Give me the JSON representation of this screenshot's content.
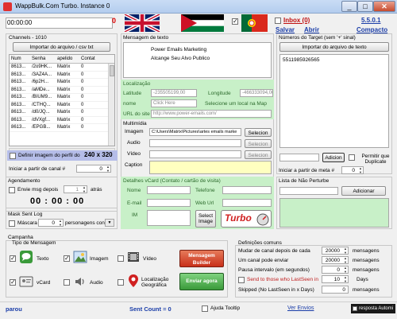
{
  "window": {
    "title": "WappBulk.Com Turbo. Instance 0",
    "min": "_",
    "max": "□",
    "close": "✕"
  },
  "top": {
    "timer": "00:00:00",
    "counter": "0",
    "inbox_label": "Inbox (0)",
    "version": "5.5.0.1",
    "links": [
      "Salvar",
      "Abrir",
      "Compacto"
    ]
  },
  "channels": {
    "title": "Channels - 1010",
    "import_button": "Importar do arquivo / csv txt",
    "columns": [
      "Num",
      "Senha",
      "apelido",
      "Contat"
    ],
    "rows": [
      [
        "8613...",
        "/2o9HK...",
        "Matrix",
        "0"
      ],
      [
        "8613...",
        "/3AZ4A...",
        "Matrix",
        "0"
      ],
      [
        "8613...",
        "/6p2H...",
        "Matrix",
        "0"
      ],
      [
        "8613...",
        "/aMDe...",
        "Matrix",
        "0"
      ],
      [
        "8613...",
        "/BIUM9...",
        "Matrix",
        "0"
      ],
      [
        "8613...",
        "/CTHQ...",
        "Matrix",
        "0"
      ],
      [
        "8613...",
        "/d0/JQ...",
        "Matrix",
        "0"
      ],
      [
        "8613...",
        "/dVXgf...",
        "Matrix",
        "0"
      ],
      [
        "8613...",
        "/EPGB...",
        "Matrix",
        "0"
      ]
    ],
    "profile_image_label": "Definir imagem do perfil do",
    "profile_size": "240 x 320",
    "start_channel_label": "Iniciar a partir de canal #",
    "start_channel_value": "0"
  },
  "message": {
    "title": "Mensagem de texto",
    "lines": [
      "Power Emails Marketing",
      "Alcange Seu Alvo Publico"
    ]
  },
  "location": {
    "title": "Localização",
    "latitude_label": "Latitude",
    "latitude_value": "-235505199,00",
    "longitude_label": "Longitude",
    "longitude_value": "-466333094,00",
    "name_label": "nome",
    "name_placeholder": "Click Here",
    "map_hint": "Selecione um local na Map",
    "url_label": "URL do site",
    "url_value": "http://www.power-emails.com/"
  },
  "media": {
    "title": "Multimídia",
    "image_label": "Imagem",
    "image_path": "C:\\Users\\Matrix\\Pictures\\artes emails marke",
    "audio_label": "Audio",
    "video_label": "Vídeo",
    "caption_label": "Caption",
    "select_button": "Selecion"
  },
  "vcard": {
    "title": "Detalhes vCard (Contato / cartão de visita)",
    "name_label": "Nome",
    "phone_label": "Telefone",
    "email_label": "E-mail",
    "web_label": "Web Url",
    "im_label": "IM",
    "select_image_button": "Select Image",
    "turbo_logo": "Turbo"
  },
  "targets": {
    "title": "Números do Target (sem '+' sinal)",
    "import_button": "Importar do arquivo de texto",
    "numbers": [
      "5511985926565"
    ],
    "add_button": "Adicion",
    "allow_duplicate_label": "Permitir que Duplicate",
    "start_meta_label": "Iniciar a partir de meta #",
    "start_meta_value": "0"
  },
  "blacklist": {
    "title": "Lista de Não Perturbe",
    "add_button": "Adicionar"
  },
  "schedule": {
    "title": "Agendamento",
    "send_after_label": "Envie msg depois",
    "send_after_value": "1",
    "unit": "atrás",
    "clock": "00 : 00 : 00"
  },
  "mask": {
    "title": "Mask Sent Log",
    "mask_label": "Máscara",
    "mask_value": "0",
    "per_contact_label": "personagens con"
  },
  "campaign": {
    "title": "Campanha",
    "type_title": "Tipo de Mensagem",
    "types": [
      {
        "label": "Texto",
        "checked": true
      },
      {
        "label": "Imagem",
        "checked": true
      },
      {
        "label": "Vídeo",
        "checked": false
      },
      {
        "label": "vCard",
        "checked": true
      },
      {
        "label": "Audio",
        "checked": false
      },
      {
        "label": "Localização Geográfica",
        "checked": false
      }
    ],
    "builder_button": "Mensagem Builder",
    "send_button": "Enviar agora"
  },
  "settings": {
    "title": "Definições comuns",
    "rows": [
      {
        "label": "Mudar de canal depois de cada",
        "value": "20000",
        "unit": "mensagens"
      },
      {
        "label": "Um canal pode enviar",
        "value": "20000",
        "unit": "mensagens"
      },
      {
        "label": "Pausa intervalo (em segundos)",
        "value": "0",
        "unit": "mensagens"
      },
      {
        "label": "Send to those who LastSeen in",
        "value": "10",
        "unit": "Days"
      },
      {
        "label": "Skipped (No LastSeen in x Days)",
        "value": "0",
        "unit": "mensagens"
      }
    ]
  },
  "status": {
    "state": "parou",
    "sent_count": "Sent Count = 0",
    "help_tooltip": "Ajuda Tooltip",
    "view_sends": "Ver Envios",
    "auto_reply": "resposta Automi"
  },
  "colors": {
    "accent_green": "#c8f0c8",
    "link_blue": "#1a3da8",
    "danger_red": "#c8301a"
  }
}
